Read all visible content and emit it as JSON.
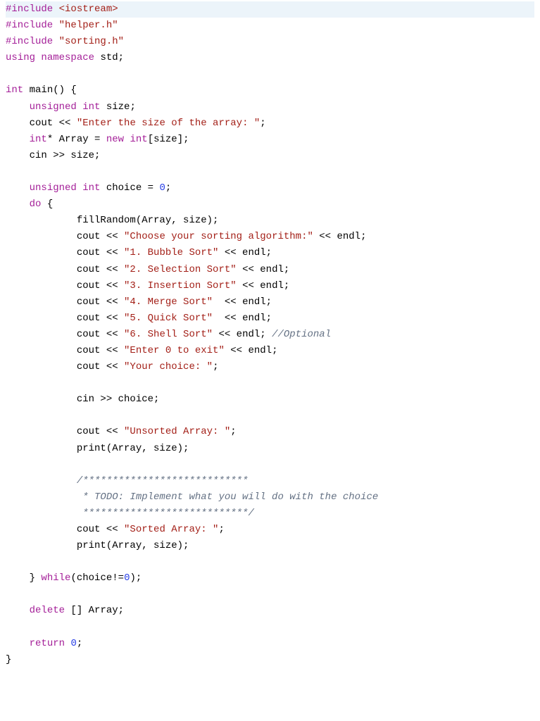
{
  "code": {
    "lines": [
      {
        "highlight": true,
        "tokens": [
          [
            "pp",
            "#include"
          ],
          [
            "black",
            " "
          ],
          [
            "inc-sys",
            "<iostream>"
          ]
        ]
      },
      {
        "tokens": [
          [
            "pp",
            "#include"
          ],
          [
            "black",
            " "
          ],
          [
            "str",
            "\"helper.h\""
          ]
        ]
      },
      {
        "tokens": [
          [
            "pp",
            "#include"
          ],
          [
            "black",
            " "
          ],
          [
            "str",
            "\"sorting.h\""
          ]
        ]
      },
      {
        "tokens": [
          [
            "kw",
            "using"
          ],
          [
            "black",
            " "
          ],
          [
            "kw",
            "namespace"
          ],
          [
            "black",
            " std;"
          ]
        ]
      },
      {
        "tokens": []
      },
      {
        "tokens": [
          [
            "kw",
            "int"
          ],
          [
            "black",
            " main() {"
          ]
        ]
      },
      {
        "tokens": [
          [
            "black",
            "    "
          ],
          [
            "kw",
            "unsigned"
          ],
          [
            "black",
            " "
          ],
          [
            "kw",
            "int"
          ],
          [
            "black",
            " size;"
          ]
        ]
      },
      {
        "tokens": [
          [
            "black",
            "    cout << "
          ],
          [
            "str",
            "\"Enter the size of the array: \""
          ],
          [
            "black",
            ";"
          ]
        ]
      },
      {
        "tokens": [
          [
            "black",
            "    "
          ],
          [
            "kw",
            "int"
          ],
          [
            "black",
            "* Array = "
          ],
          [
            "kw",
            "new"
          ],
          [
            "black",
            " "
          ],
          [
            "kw",
            "int"
          ],
          [
            "black",
            "[size];"
          ]
        ]
      },
      {
        "tokens": [
          [
            "black",
            "    cin >> size;"
          ]
        ]
      },
      {
        "tokens": []
      },
      {
        "tokens": [
          [
            "black",
            "    "
          ],
          [
            "kw",
            "unsigned"
          ],
          [
            "black",
            " "
          ],
          [
            "kw",
            "int"
          ],
          [
            "black",
            " choice = "
          ],
          [
            "num",
            "0"
          ],
          [
            "black",
            ";"
          ]
        ]
      },
      {
        "tokens": [
          [
            "black",
            "    "
          ],
          [
            "kw",
            "do"
          ],
          [
            "black",
            " {"
          ]
        ]
      },
      {
        "tokens": [
          [
            "black",
            "            fillRandom(Array, size);"
          ]
        ]
      },
      {
        "tokens": [
          [
            "black",
            "            cout << "
          ],
          [
            "str",
            "\"Choose your sorting algorithm:\""
          ],
          [
            "black",
            " << endl;"
          ]
        ]
      },
      {
        "tokens": [
          [
            "black",
            "            cout << "
          ],
          [
            "str",
            "\"1. Bubble Sort\""
          ],
          [
            "black",
            " << endl;"
          ]
        ]
      },
      {
        "tokens": [
          [
            "black",
            "            cout << "
          ],
          [
            "str",
            "\"2. Selection Sort\""
          ],
          [
            "black",
            " << endl;"
          ]
        ]
      },
      {
        "tokens": [
          [
            "black",
            "            cout << "
          ],
          [
            "str",
            "\"3. Insertion Sort\""
          ],
          [
            "black",
            " << endl;"
          ]
        ]
      },
      {
        "tokens": [
          [
            "black",
            "            cout << "
          ],
          [
            "str",
            "\"4. Merge Sort\""
          ],
          [
            "black",
            "  << endl;"
          ]
        ]
      },
      {
        "tokens": [
          [
            "black",
            "            cout << "
          ],
          [
            "str",
            "\"5. Quick Sort\""
          ],
          [
            "black",
            "  << endl;"
          ]
        ]
      },
      {
        "tokens": [
          [
            "black",
            "            cout << "
          ],
          [
            "str",
            "\"6. Shell Sort\""
          ],
          [
            "black",
            " << endl; "
          ],
          [
            "comment",
            "//Optional"
          ]
        ]
      },
      {
        "tokens": [
          [
            "black",
            "            cout << "
          ],
          [
            "str",
            "\"Enter 0 to exit\""
          ],
          [
            "black",
            " << endl;"
          ]
        ]
      },
      {
        "tokens": [
          [
            "black",
            "            cout << "
          ],
          [
            "str",
            "\"Your choice: \""
          ],
          [
            "black",
            ";"
          ]
        ]
      },
      {
        "tokens": []
      },
      {
        "tokens": [
          [
            "black",
            "            cin >> choice;"
          ]
        ]
      },
      {
        "tokens": []
      },
      {
        "tokens": [
          [
            "black",
            "            cout << "
          ],
          [
            "str",
            "\"Unsorted Array: \""
          ],
          [
            "black",
            ";"
          ]
        ]
      },
      {
        "tokens": [
          [
            "black",
            "            print(Array, size);"
          ]
        ]
      },
      {
        "tokens": []
      },
      {
        "tokens": [
          [
            "black",
            "            "
          ],
          [
            "comment",
            "/****************************"
          ]
        ]
      },
      {
        "tokens": [
          [
            "comment",
            "             * TODO: Implement what you will do with the choice"
          ]
        ]
      },
      {
        "tokens": [
          [
            "comment",
            "             ****************************/"
          ]
        ]
      },
      {
        "tokens": [
          [
            "black",
            "            cout << "
          ],
          [
            "str",
            "\"Sorted Array: \""
          ],
          [
            "black",
            ";"
          ]
        ]
      },
      {
        "tokens": [
          [
            "black",
            "            print(Array, size);"
          ]
        ]
      },
      {
        "tokens": []
      },
      {
        "tokens": [
          [
            "black",
            "    } "
          ],
          [
            "kw",
            "while"
          ],
          [
            "black",
            "(choice!="
          ],
          [
            "num",
            "0"
          ],
          [
            "black",
            ");"
          ]
        ]
      },
      {
        "tokens": []
      },
      {
        "tokens": [
          [
            "black",
            "    "
          ],
          [
            "kw",
            "delete"
          ],
          [
            "black",
            " [] Array;"
          ]
        ]
      },
      {
        "tokens": []
      },
      {
        "tokens": [
          [
            "black",
            "    "
          ],
          [
            "kw",
            "return"
          ],
          [
            "black",
            " "
          ],
          [
            "num",
            "0"
          ],
          [
            "black",
            ";"
          ]
        ]
      },
      {
        "tokens": [
          [
            "black",
            "}"
          ]
        ]
      }
    ]
  }
}
